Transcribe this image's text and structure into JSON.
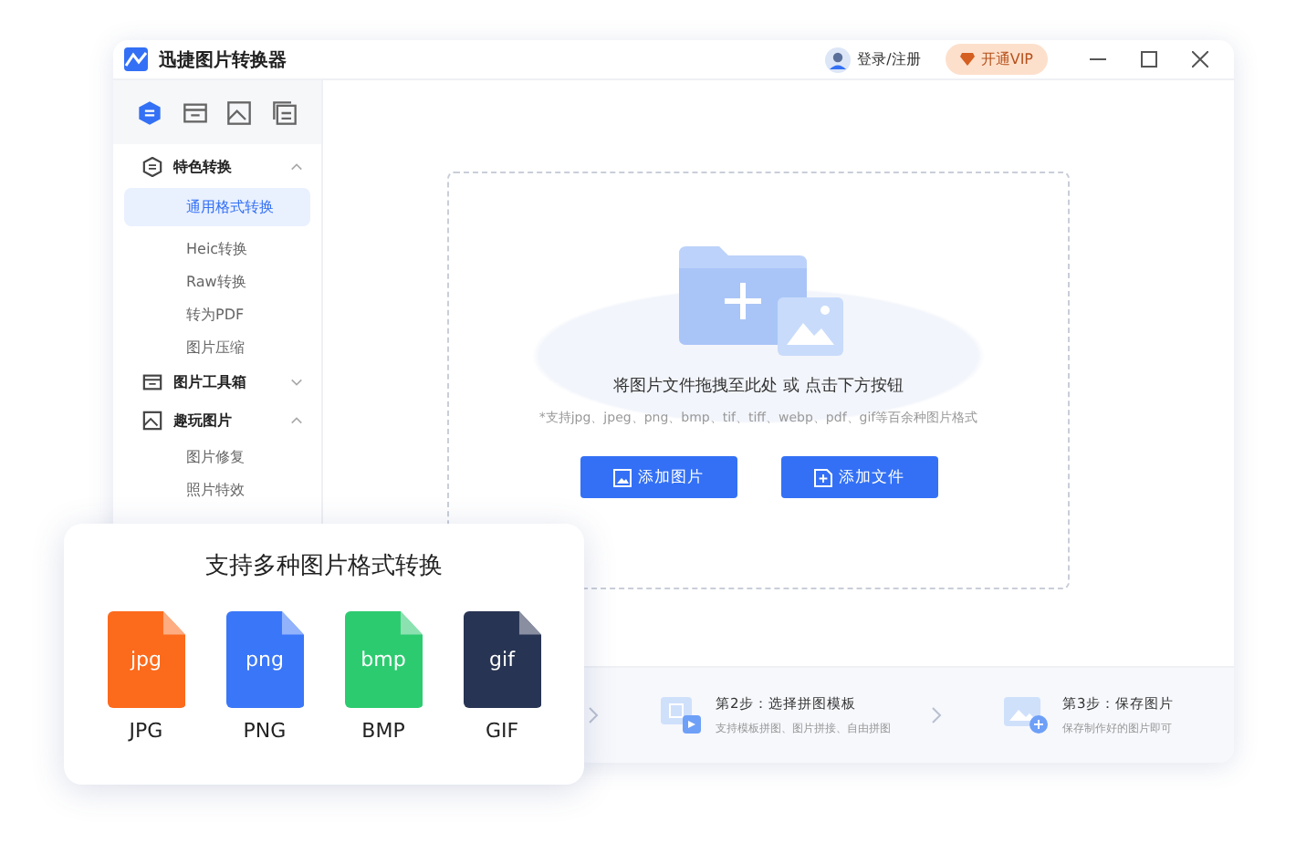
{
  "window": {
    "title": "迅捷图片转换器"
  },
  "header": {
    "login": "登录/注册",
    "vip": "开通VIP"
  },
  "sidebar": {
    "tabs": [
      {
        "selected": true
      },
      {
        "selected": false
      },
      {
        "selected": false
      },
      {
        "selected": false
      }
    ],
    "groups": [
      {
        "label": "特色转换",
        "expanded": true,
        "items": [
          {
            "label": "通用格式转换",
            "selected": true
          },
          {
            "label": "Heic转换",
            "selected": false
          },
          {
            "label": "Raw转换",
            "selected": false
          },
          {
            "label": "转为PDF",
            "selected": false
          },
          {
            "label": "图片压缩",
            "selected": false
          }
        ]
      },
      {
        "label": "图片工具箱",
        "expanded": false
      },
      {
        "label": "趣玩图片",
        "expanded": true,
        "items": [
          {
            "label": "图片修复",
            "selected": false
          },
          {
            "label": "照片特效",
            "selected": false
          }
        ]
      }
    ]
  },
  "dropzone": {
    "title": "将图片文件拖拽至此处 或 点击下方按钮",
    "hint": "*支持jpg、jpeg、png、bmp、tif、tiff、webp、pdf、gif等百余种图片格式",
    "buttons": [
      {
        "label": "添加图片",
        "kind": "image"
      },
      {
        "label": "添加文件",
        "kind": "file"
      }
    ]
  },
  "steps": [
    {
      "title": "第2步：选择拼图模板",
      "desc": "支持模板拼图、图片拼接、自由拼图",
      "kind": "template"
    },
    {
      "title": "第3步：保存图片",
      "desc": "保存制作好的图片即可",
      "kind": "save"
    }
  ],
  "format_card": {
    "title": "支持多种图片格式转换",
    "formats": [
      {
        "ext": "jpg",
        "label": "JPG",
        "color": "#fc6a1b"
      },
      {
        "ext": "png",
        "label": "PNG",
        "color": "#3a76f8"
      },
      {
        "ext": "bmp",
        "label": "BMP",
        "color": "#2dcb70"
      },
      {
        "ext": "gif",
        "label": "GIF",
        "color": "#283453"
      }
    ]
  }
}
